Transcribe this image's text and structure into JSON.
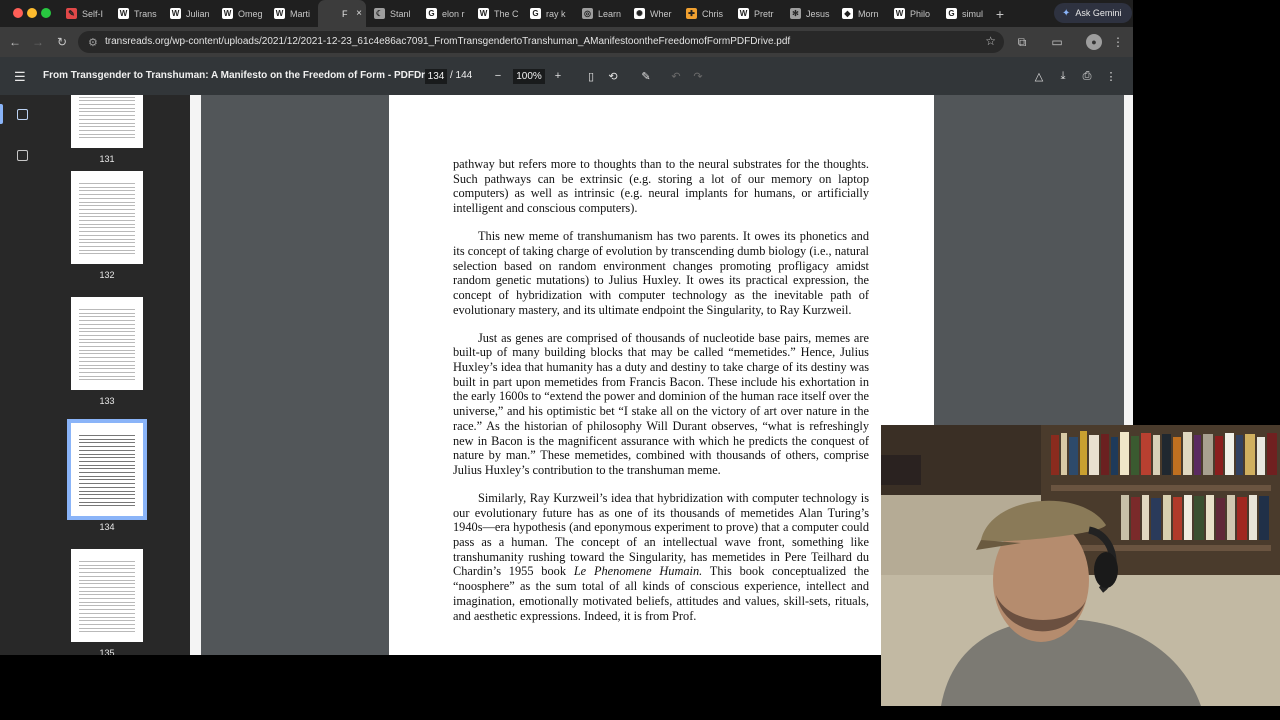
{
  "window": {
    "traffic_lights": [
      "#ff5f57",
      "#febc2e",
      "#28c840"
    ]
  },
  "tabs": [
    {
      "label": "Self-I",
      "icon": "pen-icon",
      "icon_color": "#e04848",
      "active": false
    },
    {
      "label": "Trans",
      "icon": "wikipedia-icon",
      "icon_color": "#ffffff",
      "active": false
    },
    {
      "label": "Julian",
      "icon": "wikipedia-icon",
      "icon_color": "#ffffff",
      "active": false
    },
    {
      "label": "Omeg",
      "icon": "wikipedia-icon",
      "icon_color": "#ffffff",
      "active": false
    },
    {
      "label": "Marti",
      "icon": "wikipedia-icon",
      "icon_color": "#ffffff",
      "active": false
    },
    {
      "label": "F",
      "icon": "document-icon",
      "icon_color": "#3c3c3c",
      "active": true
    },
    {
      "label": "Stanl",
      "icon": "moon-icon",
      "icon_color": "#9e9e9e",
      "active": false
    },
    {
      "label": "elon r",
      "icon": "google-icon",
      "icon_color": "#ffffff",
      "active": false
    },
    {
      "label": "The C",
      "icon": "wikipedia-icon",
      "icon_color": "#ffffff",
      "active": false
    },
    {
      "label": "ray k",
      "icon": "google-icon",
      "icon_color": "#ffffff",
      "active": false
    },
    {
      "label": "Learn",
      "icon": "compass-icon",
      "icon_color": "#9e9e9e",
      "active": false
    },
    {
      "label": "Wher",
      "icon": "chatgpt-icon",
      "icon_color": "#ffffff",
      "active": false
    },
    {
      "label": "Chris",
      "icon": "cross-icon",
      "icon_color": "#f0a030",
      "active": false
    },
    {
      "label": "Pretr",
      "icon": "wikipedia-icon",
      "icon_color": "#ffffff",
      "active": false
    },
    {
      "label": "Jesus",
      "icon": "perplexity-icon",
      "icon_color": "#9e9e9e",
      "active": false
    },
    {
      "label": "Morn",
      "icon": "shield-icon",
      "icon_color": "#ffffff",
      "active": false
    },
    {
      "label": "Philo",
      "icon": "wikipedia-icon",
      "icon_color": "#ffffff",
      "active": false
    },
    {
      "label": "simul",
      "icon": "google-icon",
      "icon_color": "#ffffff",
      "active": false
    }
  ],
  "gemini": {
    "label": "Ask Gemini",
    "icon": "sparkle-icon"
  },
  "address": {
    "url": "transreads.org/wp-content/uploads/2021/12/2021-12-23_61c4e86ac7091_FromTransgendertoTranshuman_AManifestoontheFreedomofFormPDFDrive.pdf"
  },
  "pdf_toolbar": {
    "title": "From Transgender to Transhuman: A Manifesto on the Freedom of Form - PDFDriv...",
    "current_page": "134",
    "total_pages": "/ 144",
    "zoom": "100%"
  },
  "thumbnails": [
    {
      "number": "131",
      "selected": false
    },
    {
      "number": "132",
      "selected": false
    },
    {
      "number": "133",
      "selected": false
    },
    {
      "number": "134",
      "selected": true
    },
    {
      "number": "135",
      "selected": false
    }
  ],
  "page_text": {
    "p1": "pathway but refers more to thoughts than to the neural substrates for the thoughts. Such pathways can be extrinsic (e.g. storing a lot of our memory on laptop computers) as well as intrinsic (e.g. neural implants for humans, or artificially intelligent and conscious computers).",
    "p2": "This new meme of transhumanism has two parents. It owes its phonetics and its concept of taking charge of evolution by transcending dumb biology (i.e., natural selection based on random environment changes promoting profligacy amidst random genetic mutations) to Julius Huxley. It owes its practical expression, the concept of hybridization with computer technology as the inevitable path of evolutionary mastery, and its ultimate endpoint the Singularity, to Ray Kurzweil.",
    "p3": "Just as genes are comprised of thousands of nucleotide base pairs, memes are built-up of many building blocks that may be called “memetides.” Hence, Julius Huxley’s idea that humanity has a duty and destiny to take charge of its destiny was built in part upon memetides from Francis Bacon. These include his exhortation in the early 1600s to “extend the power and dominion of the human race itself over the universe,” and his optimistic bet “I stake all on the victory of art over nature in the race.” As the historian of philosophy Will Durant observes, “what is refreshingly new in Bacon is the magnificent assurance with which he predicts the conquest of nature by man.” These memetides, combined with thousands of others, comprise Julius Huxley’s contribution to the transhuman meme.",
    "p4a": "Similarly, Ray Kurzweil’s idea that hybridization with computer technology is our evolutionary future has as one of its thousands of memetides Alan Turing’s 1940s—era hypothesis (and eponymous experiment to prove) that a computer could pass as a human. The concept of an intellectual wave front, something like transhumanity rushing toward the Singularity, has memetides in Pere Teilhard du Chardin’s 1955 book ",
    "p4b": "Le Phenomene Humain.",
    "p4c": " This book conceptualized the “noosphere” as the sum total of all kinds of conscious experience, intellect and imagination, emotionally motivated beliefs, attitudes and values, skill-sets, rituals, and aesthetic expressions. Indeed, it is from Prof."
  },
  "colors": {
    "accent": "#8ab4f8",
    "pdf_toolbar_bg": "#323639",
    "doc_bg": "#525659"
  }
}
